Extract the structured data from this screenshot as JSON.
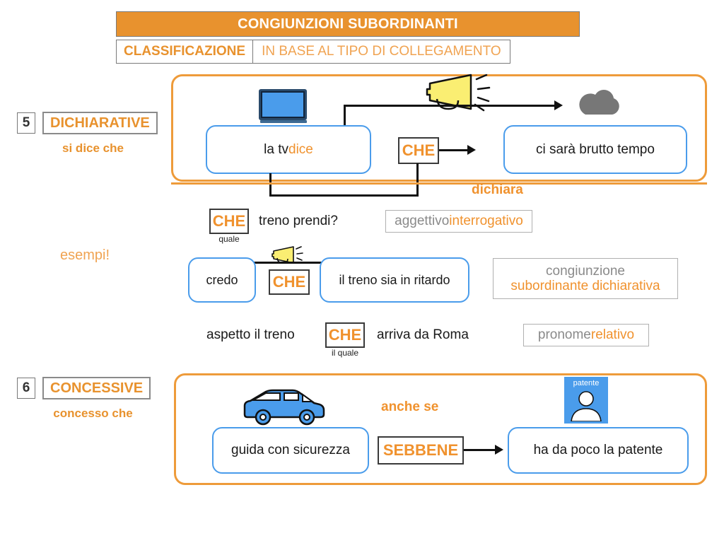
{
  "header": {
    "title": "CONGIUNZIONI SUBORDINANTI",
    "classification_label": "CLASSIFICAZIONE",
    "classification_desc": "IN BASE AL TIPO DI COLLEGAMENTO",
    "banner_color": "#E8922E",
    "accent_color": "#F0922E"
  },
  "sections": [
    {
      "number": "5",
      "name": "DICHIARATIVE",
      "subtitle": "si dice che",
      "left_phrase": "la tv ",
      "left_phrase_accent": "dice",
      "keyword": "CHE",
      "right_phrase": "ci sarà brutto tempo",
      "relation_label": "dichiara",
      "icons": {
        "left": "tv-icon",
        "mid": "megaphone-icon",
        "right": "cloud-icon"
      }
    },
    {
      "number": "6",
      "name": "CONCESSIVE",
      "subtitle": "concesso che",
      "left_phrase": "guida con sicurezza",
      "keyword": "SEBBENE",
      "right_phrase": "ha da poco la patente",
      "relation_label": "anche se",
      "icons": {
        "left": "car-icon",
        "right": "id-card-icon"
      },
      "id_card_label": "patente"
    }
  ],
  "examples": {
    "label": "esempi!",
    "rows": [
      {
        "keyword": "CHE",
        "keyword_sub": "quale",
        "text_after": "treno prendi?",
        "tag_gray": "aggettivo ",
        "tag_orange": "interrogativo"
      },
      {
        "left_phrase": "credo",
        "keyword": "CHE",
        "right_phrase": "il treno sia in ritardo",
        "tag_gray": "congiunzione",
        "tag_orange": "subordinante dichiarativa",
        "icon": "megaphone-icon"
      },
      {
        "text_before": "aspetto il treno",
        "keyword": "CHE",
        "keyword_sub": "il quale",
        "text_after": "arriva da Roma",
        "tag_gray": "pronome ",
        "tag_orange": "relativo"
      }
    ]
  }
}
